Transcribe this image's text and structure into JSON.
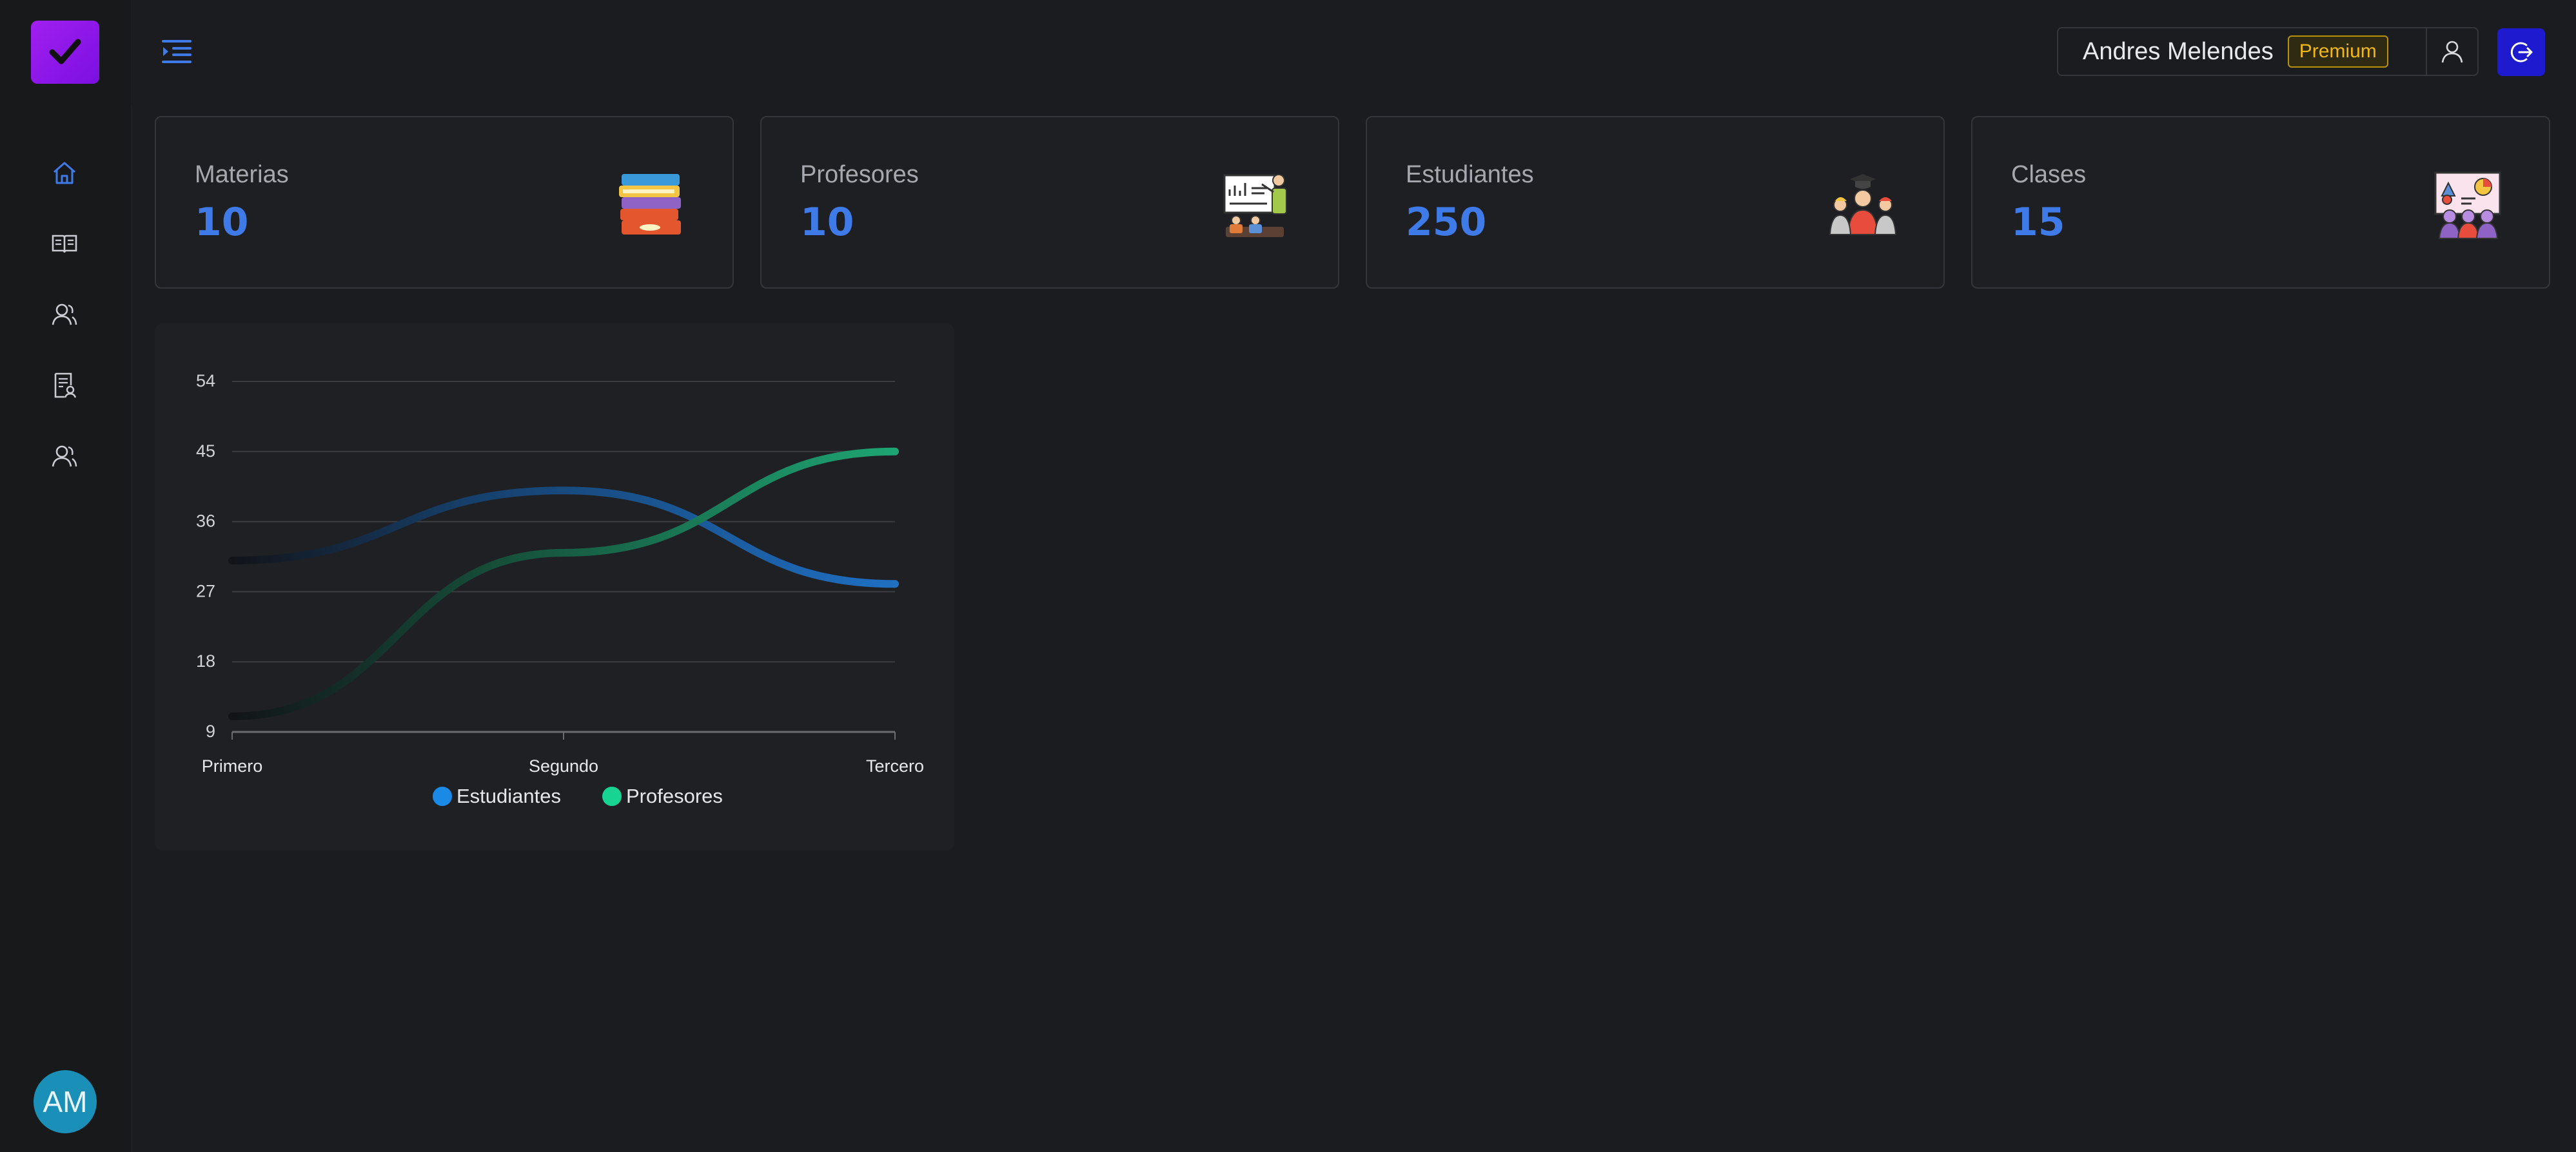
{
  "user": {
    "name": "Andres Melendes",
    "plan_badge": "Premium",
    "initials": "AM"
  },
  "sidebar": {
    "items": [
      {
        "icon": "home-icon",
        "active": true
      },
      {
        "icon": "book-open-icon",
        "active": false
      },
      {
        "icon": "users-icon",
        "active": false
      },
      {
        "icon": "report-icon",
        "active": false
      },
      {
        "icon": "users-icon",
        "active": false
      }
    ]
  },
  "stats": [
    {
      "label": "Materias",
      "value": "10",
      "icon": "books-icon"
    },
    {
      "label": "Profesores",
      "value": "10",
      "icon": "teacher-board-icon"
    },
    {
      "label": "Estudiantes",
      "value": "250",
      "icon": "students-graduation-icon"
    },
    {
      "label": "Clases",
      "value": "15",
      "icon": "class-presentation-icon"
    }
  ],
  "colors": {
    "accent": "#3f7be8",
    "brand": "#9b1cf0",
    "estudiantes": "#1f6fc2",
    "profesores": "#1ea574"
  },
  "chart_data": {
    "type": "line",
    "categories": [
      "Primero",
      "Segundo",
      "Tercero"
    ],
    "series": [
      {
        "name": "Estudiantes",
        "values": [
          31,
          40,
          28
        ]
      },
      {
        "name": "Profesores",
        "values": [
          11,
          32,
          45
        ]
      }
    ],
    "yticks": [
      9,
      18,
      27,
      36,
      45,
      54
    ],
    "ylim": [
      9,
      54
    ],
    "grid": true,
    "legend": "bottom",
    "curve": "smooth"
  }
}
